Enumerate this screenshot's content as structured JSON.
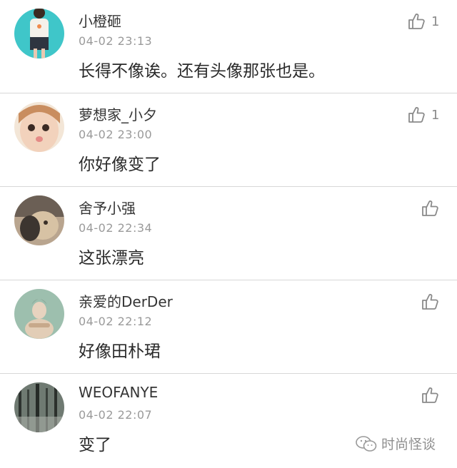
{
  "comments": [
    {
      "username": "小橙砸",
      "timestamp": "04-02 23:13",
      "text": "长得不像诶。还有头像那张也是。",
      "likes": "1",
      "avatar_icon": "avatar-icon"
    },
    {
      "username": "萝想家_小夕",
      "timestamp": "04-02 23:00",
      "text": "你好像变了",
      "likes": "1",
      "avatar_icon": "avatar-icon"
    },
    {
      "username": "舍予小强",
      "timestamp": "04-02 22:34",
      "text": "这张漂亮",
      "likes": "",
      "avatar_icon": "avatar-icon"
    },
    {
      "username": "亲爱的DerDer",
      "timestamp": "04-02 22:12",
      "text": "好像田朴珺",
      "likes": "",
      "avatar_icon": "avatar-icon"
    },
    {
      "username": "WEOFANYE",
      "timestamp": "04-02 22:07",
      "text": "变了",
      "likes": "",
      "avatar_icon": "avatar-icon"
    }
  ],
  "watermark": {
    "text": "时尚怪谈",
    "icon": "wechat-icon"
  },
  "colors": {
    "divider": "#d7d7d7",
    "timestamp": "#9a9a9a",
    "thumb": "#8a8a8a"
  }
}
